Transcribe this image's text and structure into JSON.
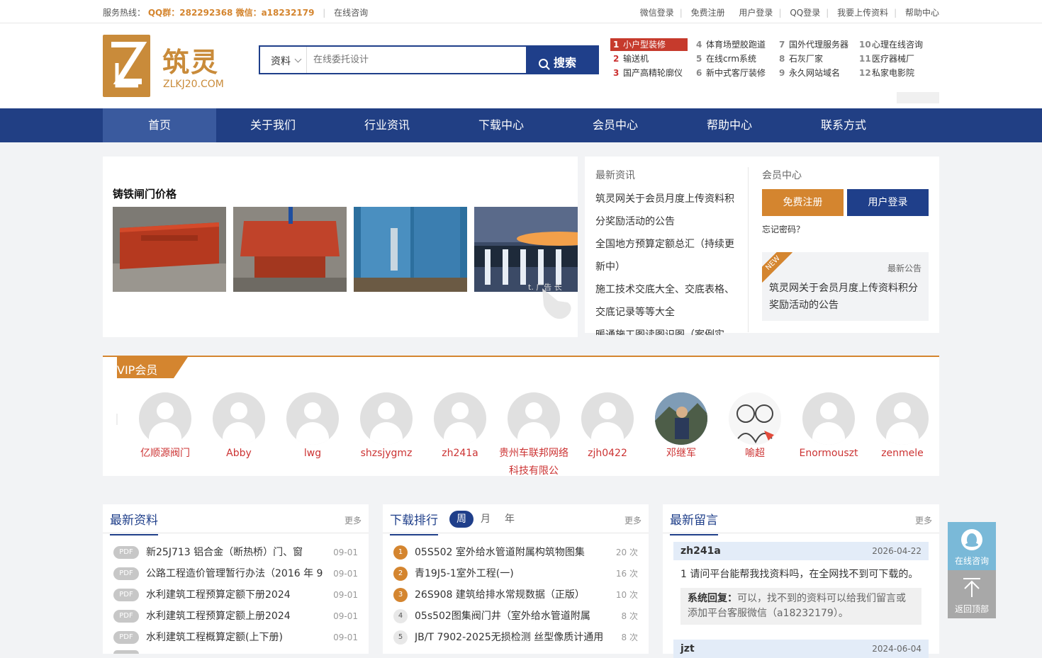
{
  "topbar": {
    "hotline_label": "服务热线：",
    "qq_wechat": "QQ群：282292368 微信：a18232179",
    "online": "在线咨询",
    "links": [
      "微信登录",
      "免费注册",
      "用户登录",
      "QQ登录",
      "我要上传资料",
      "帮助中心"
    ]
  },
  "logo": {
    "cn": "筑灵",
    "en": "ZLKJ20.COM"
  },
  "search": {
    "category": "资料",
    "placeholder": "在线委托设计",
    "button": "搜索"
  },
  "hot": [
    {
      "n": "1",
      "t": "小户型装修"
    },
    {
      "n": "2",
      "t": "输送机"
    },
    {
      "n": "3",
      "t": "国产高精轮廓仪"
    },
    {
      "n": "4",
      "t": "体育场塑胶跑道"
    },
    {
      "n": "5",
      "t": "在线crm系统"
    },
    {
      "n": "6",
      "t": "新中式客厅装修"
    },
    {
      "n": "7",
      "t": "国外代理服务器"
    },
    {
      "n": "8",
      "t": "石灰厂家"
    },
    {
      "n": "9",
      "t": "永久网站域名"
    },
    {
      "n": "10",
      "t": "心理在线咨询"
    },
    {
      "n": "11",
      "t": "医疗器械厂"
    },
    {
      "n": "12",
      "t": "私家电影院"
    }
  ],
  "nav": [
    "首页",
    "关于我们",
    "行业资讯",
    "下载中心",
    "会员中心",
    "帮助中心",
    "联系方式"
  ],
  "slider": {
    "title": "铸铁闸门价格",
    "watermark": "t. 广告 长"
  },
  "news": {
    "heading": "最新资讯",
    "items": [
      "筑灵网关于会员月度上传资料积分奖励活动的公告",
      "全国地方预算定额总汇（持续更新中）",
      "施工技术交底大全、交底表格、交底记录等等大全",
      "暖通施工图读图识图（案例实"
    ]
  },
  "member": {
    "heading": "会员中心",
    "register": "免费注册",
    "login": "用户登录",
    "forgot": "忘记密码？",
    "notice_ribbon": "NEW",
    "notice_label": "最新公告",
    "notice_text": "筑灵网关于会员月度上传资料积分奖励活动的公告"
  },
  "vip": {
    "title": "VIP会员",
    "members": [
      "亿顺源阀门",
      "Abby",
      "lwg",
      "shzsjygmz",
      "zh241a",
      "贵州车联邦网络科技有限公",
      "zjh0422",
      "邓继军",
      "喻超",
      "Enormouszt",
      "zenmele"
    ]
  },
  "latest": {
    "title": "最新资料",
    "more": "更多",
    "rows": [
      {
        "tag": "PDF",
        "t": "新25J713 铝合金（断热桥）门、窗",
        "d": "09-01"
      },
      {
        "tag": "PDF",
        "t": "公路工程造价管理暂行办法（2016 年 9",
        "d": "09-01"
      },
      {
        "tag": "PDF",
        "t": "水利建筑工程预算定额下册2024",
        "d": "09-01"
      },
      {
        "tag": "PDF",
        "t": "水利建筑工程预算定额上册2024",
        "d": "09-01"
      },
      {
        "tag": "PDF",
        "t": "水利建筑工程概算定额(上下册)",
        "d": "09-01"
      }
    ]
  },
  "ranking": {
    "title": "下载排行",
    "tabs": [
      "周",
      "月",
      "年"
    ],
    "more": "更多",
    "rows": [
      {
        "n": "1",
        "t": "05S502 室外给水管道附属构筑物图集",
        "c": "20 次"
      },
      {
        "n": "2",
        "t": "青19J5-1室外工程(一)",
        "c": "16 次"
      },
      {
        "n": "3",
        "t": "26S908 建筑给排水常规数据（正版）",
        "c": "10 次"
      },
      {
        "n": "4",
        "t": "05s502图集阀门井（室外给水管道附属",
        "c": "8 次"
      },
      {
        "n": "5",
        "t": "JB/T 7902-2025无损检测 丝型像质计通用",
        "c": "8 次"
      }
    ]
  },
  "messages": {
    "title": "最新留言",
    "more": "更多",
    "items": [
      {
        "user": "zh241a",
        "date": "2026-04-22",
        "q": "1 请问平台能帮我找资料吗，在全网找不到可下载的。",
        "reply_label": "系统回复：",
        "reply": "可以，找不到的资料可以给我们留言或添加平台客服微信（a18232179）。"
      },
      {
        "user": "jzt",
        "date": "2024-06-04"
      }
    ]
  },
  "float": {
    "consult": "在线咨询",
    "top": "返回顶部"
  },
  "colors": {
    "brand": "#1f3f8a",
    "accent": "#d4852f",
    "hot_red": "#c63a2c"
  }
}
